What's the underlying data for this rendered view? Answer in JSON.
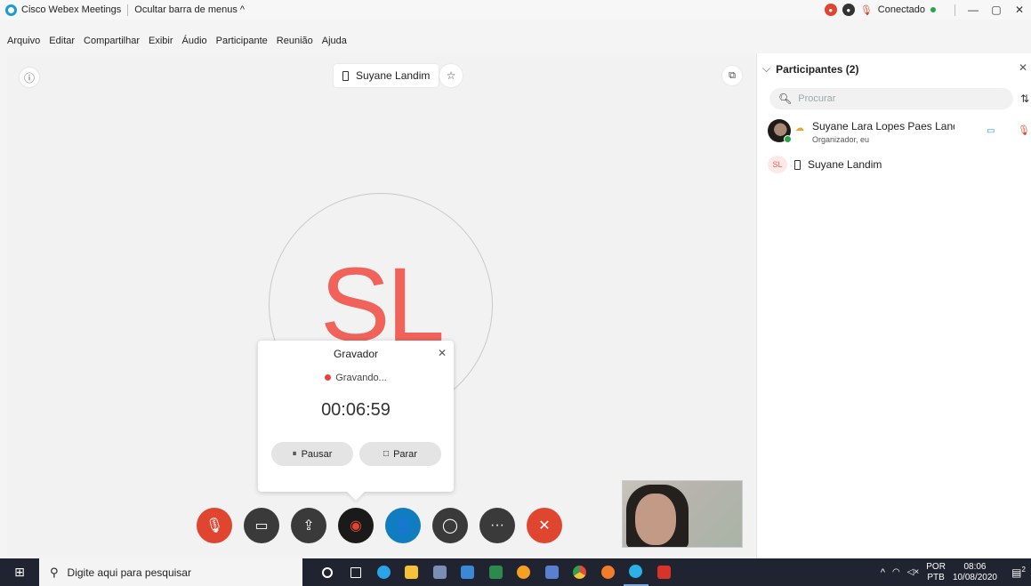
{
  "titlebar": {
    "app_title": "Cisco Webex Meetings",
    "hide_menu_label": "Ocultar barra de menus",
    "hide_menu_caret": "^",
    "status_label": "Conectado",
    "minimize": "—",
    "restore": "▢",
    "close": "✕"
  },
  "menubar": {
    "items": [
      "Arquivo",
      "Editar",
      "Compartilhar",
      "Exibir",
      "Áudio",
      "Participante",
      "Reunião",
      "Ajuda"
    ]
  },
  "stage": {
    "speaker_name": "Suyane Landim",
    "avatar_initials": "SL"
  },
  "recorder": {
    "title": "Gravador",
    "close": "✕",
    "status": "Gravando...",
    "elapsed": "00:06:59",
    "pause_label": "Pausar",
    "stop_label": "Parar",
    "pause_icon": "⏸",
    "stop_icon": "□"
  },
  "controls": {
    "mute": "🎙",
    "video": "▭",
    "share": "⇪",
    "record": "◉",
    "participants": "👤",
    "chat": "◯",
    "more": "···",
    "leave": "✕"
  },
  "participants_panel": {
    "title": "Participantes (2)",
    "chevron": "⌵",
    "close": "✕",
    "search_placeholder": "Procurar",
    "sort_icon": "⇅",
    "items": [
      {
        "name": "Suyane Lara Lopes Paes Landi...",
        "role": "Organizador, eu"
      },
      {
        "name": "Suyane Landim",
        "initials": "SL"
      }
    ]
  },
  "taskbar": {
    "search_placeholder": "Digite aqui para pesquisar",
    "lang_top": "POR",
    "lang_bottom": "PTB",
    "time": "08:06",
    "date": "10/08/2020",
    "notif_count": "2",
    "tray_arrow": "^",
    "volume": "◁×"
  },
  "colors": {
    "accent_red": "#e0462f",
    "brand_blue": "#0f7dbf",
    "avatar_red": "#f0625a",
    "taskbar_bg": "#1f2430"
  },
  "icons": {
    "taskbar": [
      "cortana-icon",
      "task-view-icon",
      "edge-icon",
      "file-explorer-icon",
      "app-icon",
      "app-icon",
      "excel-icon",
      "app-icon",
      "word-icon",
      "chrome-icon",
      "brave-icon",
      "webex-icon",
      "acrobat-icon"
    ]
  }
}
